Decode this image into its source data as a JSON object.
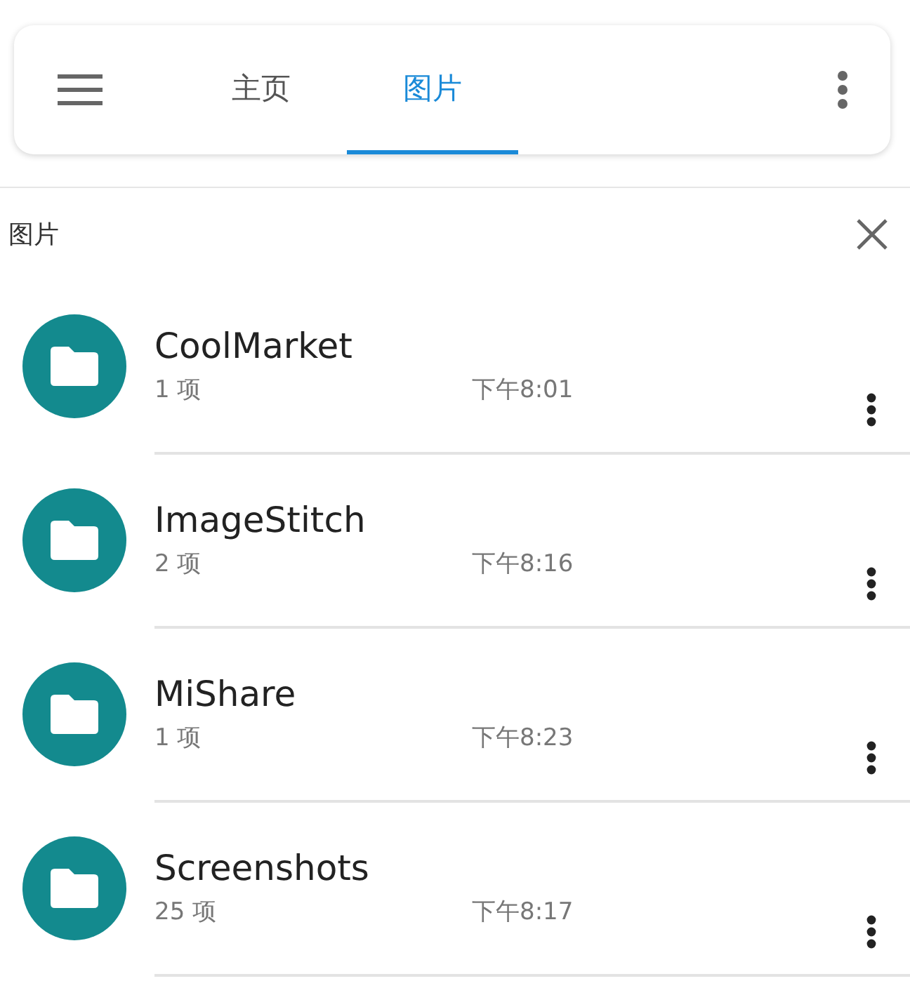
{
  "tabs": [
    {
      "label": "主页",
      "selected": false
    },
    {
      "label": "图片",
      "selected": true
    }
  ],
  "header": {
    "title": "图片"
  },
  "folders": [
    {
      "name": "CoolMarket",
      "count": "1 项",
      "time": "下午8:01"
    },
    {
      "name": "ImageStitch",
      "count": "2 项",
      "time": "下午8:16"
    },
    {
      "name": "MiShare",
      "count": "1 项",
      "time": "下午8:23"
    },
    {
      "name": "Screenshots",
      "count": "25 项",
      "time": "下午8:17"
    }
  ]
}
